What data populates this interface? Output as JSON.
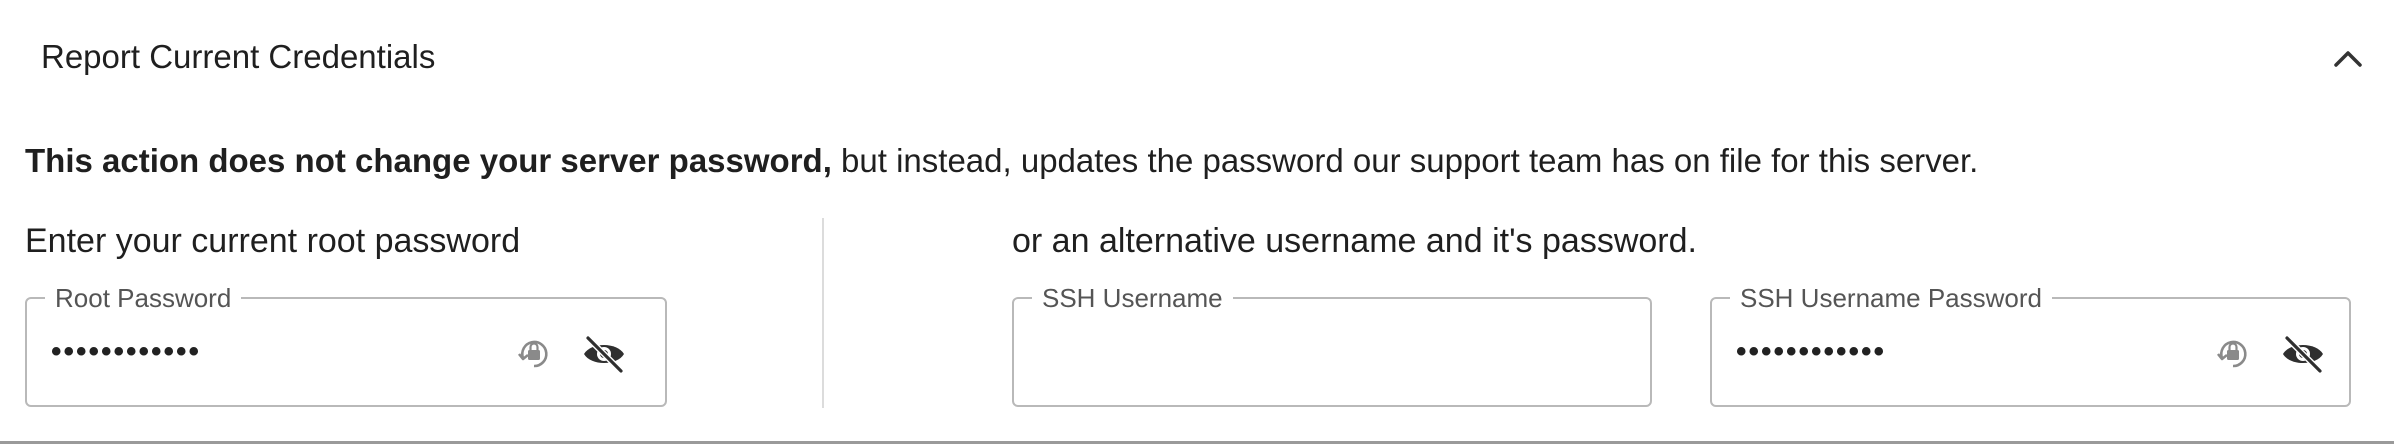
{
  "header": {
    "title": "Report Current Credentials",
    "collapse_icon": "chevron-up-icon"
  },
  "notice": {
    "bold": "This action does not change your server password,",
    "rest": " but instead, updates the password our support team has on file for this server."
  },
  "left_column": {
    "label": "Enter your current root password",
    "field": {
      "legend": "Root Password",
      "value": "••••••••••••",
      "icons": [
        "lock-refresh-icon",
        "eye-off-icon"
      ]
    }
  },
  "right_column": {
    "label": "or an alternative username and it's password.",
    "username_field": {
      "legend": "SSH Username",
      "value": ""
    },
    "password_field": {
      "legend": "SSH Username Password",
      "value": "••••••••••••",
      "icons": [
        "lock-refresh-icon",
        "eye-off-icon"
      ]
    }
  }
}
